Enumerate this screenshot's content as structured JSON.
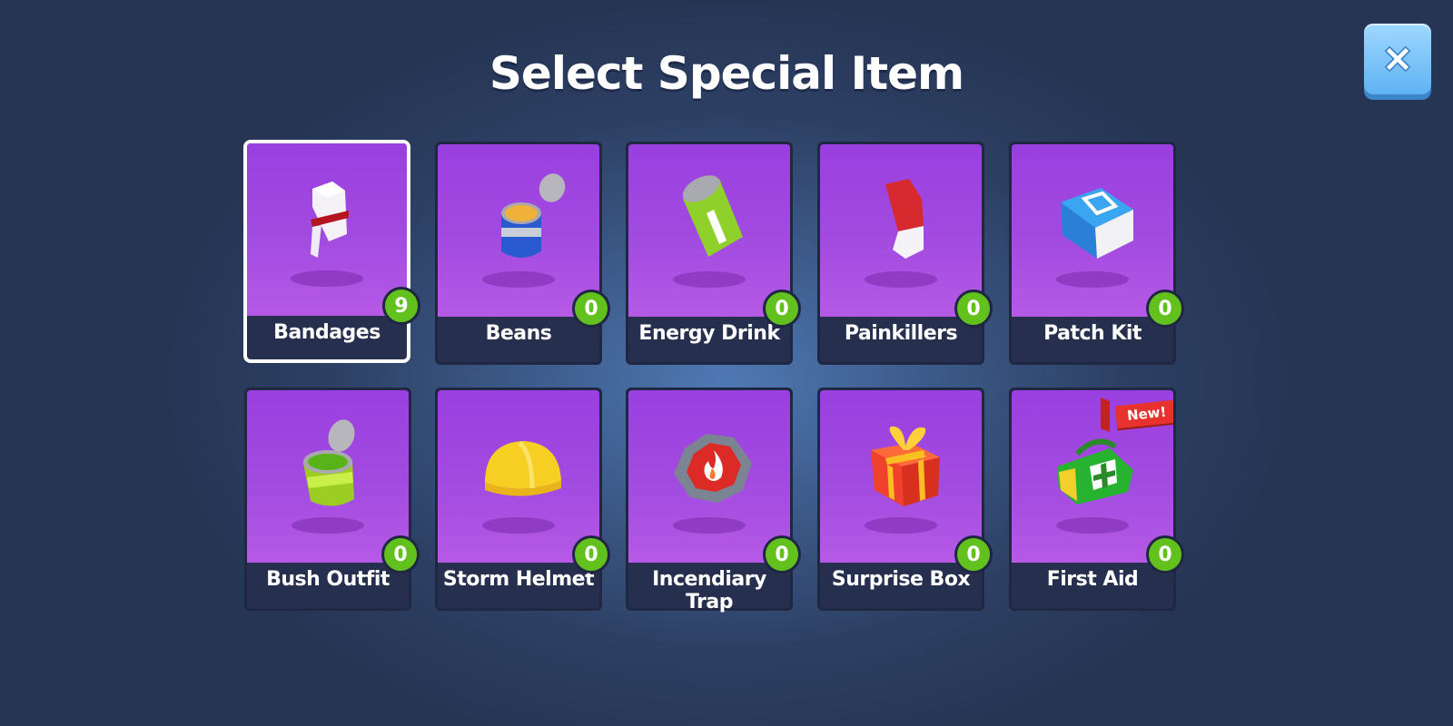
{
  "header": {
    "title": "Select Special Item"
  },
  "close_button": {
    "icon": "close-icon"
  },
  "colors": {
    "card_art": "#a24be0",
    "count_badge": "#62c11c",
    "new_badge": "#e8322e",
    "close_button": "#5fb2f3"
  },
  "items": [
    {
      "label": "Bandages",
      "count": "9",
      "icon": "bandage-icon",
      "selected": true
    },
    {
      "label": "Beans",
      "count": "0",
      "icon": "beans-can-icon"
    },
    {
      "label": "Energy Drink",
      "count": "0",
      "icon": "energy-drink-icon"
    },
    {
      "label": "Painkillers",
      "count": "0",
      "icon": "pill-icon"
    },
    {
      "label": "Patch Kit",
      "count": "0",
      "icon": "patch-kit-icon"
    },
    {
      "label": "Bush Outfit",
      "count": "0",
      "icon": "bush-can-icon"
    },
    {
      "label": "Storm Helmet",
      "count": "0",
      "icon": "helmet-icon"
    },
    {
      "label": "Incendiary Trap",
      "count": "0",
      "icon": "fire-trap-icon"
    },
    {
      "label": "Surprise Box",
      "count": "0",
      "icon": "gift-box-icon"
    },
    {
      "label": "First Aid",
      "count": "0",
      "icon": "first-aid-kit-icon",
      "badge": "New!"
    }
  ]
}
